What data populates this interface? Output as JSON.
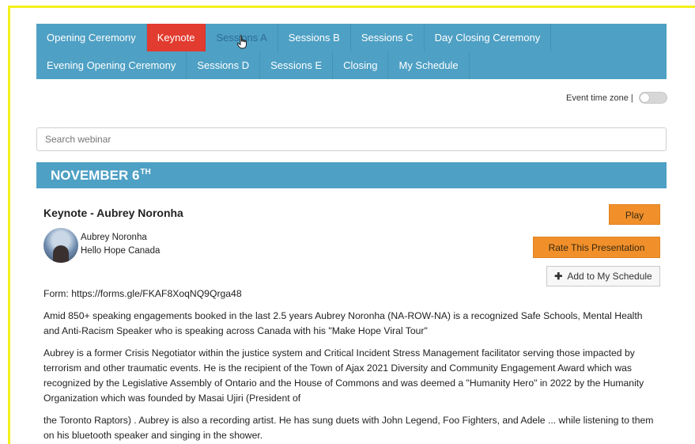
{
  "tabs": {
    "row1": [
      "Opening Ceremony",
      "Keynote",
      "Sessions A",
      "Sessions B",
      "Sessions C",
      "Day Closing Ceremony"
    ],
    "row2": [
      "Evening Opening Ceremony",
      "Sessions D",
      "Sessions E",
      "Closing",
      "My Schedule"
    ],
    "active": "Keynote",
    "hovered": "Sessions A"
  },
  "timezone": {
    "label": "Event time zone |",
    "enabled": false
  },
  "search": {
    "placeholder": "Search webinar",
    "value": ""
  },
  "date": {
    "text": "NOVEMBER 6",
    "suffix": "TH"
  },
  "session": {
    "title": "Keynote - Aubrey Noronha",
    "speaker_name": "Aubrey Noronha",
    "speaker_org": "Hello Hope Canada",
    "play_label": "Play",
    "rate_label": "Rate This Presentation",
    "schedule_label": "Add to My Schedule",
    "form_line": "Form: https://forms.gle/FKAF8XoqNQ9Qrga48",
    "paragraph1": "Amid 850+ speaking engagements booked in the last 2.5 years Aubrey Noronha (NA-ROW-NA) is a recognized Safe Schools, Mental Health and Anti-Racism Speaker who is speaking across Canada with his \"Make Hope Viral Tour\"",
    "paragraph2": "Aubrey is a former Crisis Negotiator within the justice system and Critical Incident Stress Management facilitator serving those impacted by terrorism and other traumatic events. He is the recipient of the Town of Ajax 2021 Diversity and Community Engagement Award which was recognized by the Legislative Assembly of Ontario and the House of Commons and was deemed a \"Humanity Hero\" in 2022 by the Humanity Organization which was founded by Masai Ujiri (President of",
    "paragraph3": "the Toronto Raptors) . Aubrey is also a recording artist. He has sung duets with John Legend, Foo Fighters, and Adele ... while listening to them on his bluetooth speaker and singing in the shower."
  },
  "colors": {
    "tab_bar": "#4ea0c4",
    "active_tab": "#e23b2f",
    "accent_button": "#f1902b",
    "frame": "#f4f01d"
  },
  "icons": {
    "cursor": "hand-pointer-icon",
    "add": "plus-icon"
  }
}
